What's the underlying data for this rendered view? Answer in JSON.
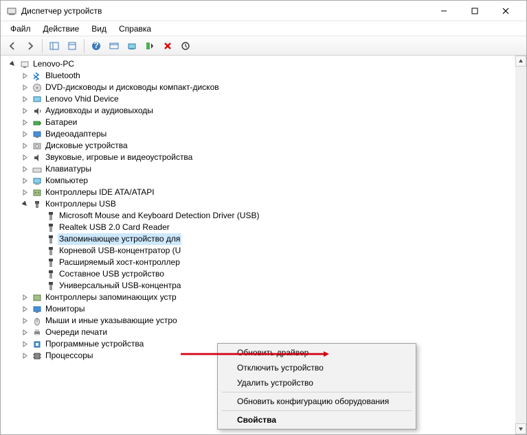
{
  "window": {
    "title": "Диспетчер устройств"
  },
  "menubar": {
    "items": [
      "Файл",
      "Действие",
      "Вид",
      "Справка"
    ]
  },
  "tree": {
    "root": "Lenovo-PC",
    "categories": [
      {
        "label": "Bluetooth",
        "icon": "bluetooth"
      },
      {
        "label": "DVD-дисководы и дисководы компакт-дисков",
        "icon": "disc"
      },
      {
        "label": "Lenovo Vhid Device",
        "icon": "vhid"
      },
      {
        "label": "Аудиовходы и аудиовыходы",
        "icon": "audio"
      },
      {
        "label": "Батареи",
        "icon": "battery"
      },
      {
        "label": "Видеоадаптеры",
        "icon": "display"
      },
      {
        "label": "Дисковые устройства",
        "icon": "disk"
      },
      {
        "label": "Звуковые, игровые и видеоустройства",
        "icon": "sound"
      },
      {
        "label": "Клавиатуры",
        "icon": "keyboard"
      },
      {
        "label": "Компьютер",
        "icon": "computer"
      },
      {
        "label": "Контроллеры IDE ATA/ATAPI",
        "icon": "ide"
      }
    ],
    "usb": {
      "label": "Контроллеры USB",
      "children": [
        "Microsoft Mouse and Keyboard Detection Driver (USB)",
        "Realtek USB 2.0 Card Reader",
        "Запоминающее устройство для",
        "Корневой USB-концентратор (U",
        "Расширяемый хост-контроллер",
        "Составное USB устройство",
        "Универсальный USB-концентра"
      ],
      "selected_index": 2
    },
    "after": [
      {
        "label": "Контроллеры запоминающих устр",
        "icon": "storage-ctrl"
      },
      {
        "label": "Мониторы",
        "icon": "monitor"
      },
      {
        "label": "Мыши и иные указывающие устро",
        "icon": "mouse"
      },
      {
        "label": "Очереди печати",
        "icon": "printer"
      },
      {
        "label": "Программные устройства",
        "icon": "software"
      },
      {
        "label": "Процессоры",
        "icon": "cpu"
      }
    ]
  },
  "context_menu": {
    "items": [
      {
        "label": "Обновить драйвер",
        "type": "item"
      },
      {
        "label": "Отключить устройство",
        "type": "item"
      },
      {
        "label": "Удалить устройство",
        "type": "item"
      },
      {
        "type": "sep"
      },
      {
        "label": "Обновить конфигурацию оборудования",
        "type": "item"
      },
      {
        "type": "sep"
      },
      {
        "label": "Свойства",
        "type": "item",
        "bold": true
      }
    ]
  }
}
